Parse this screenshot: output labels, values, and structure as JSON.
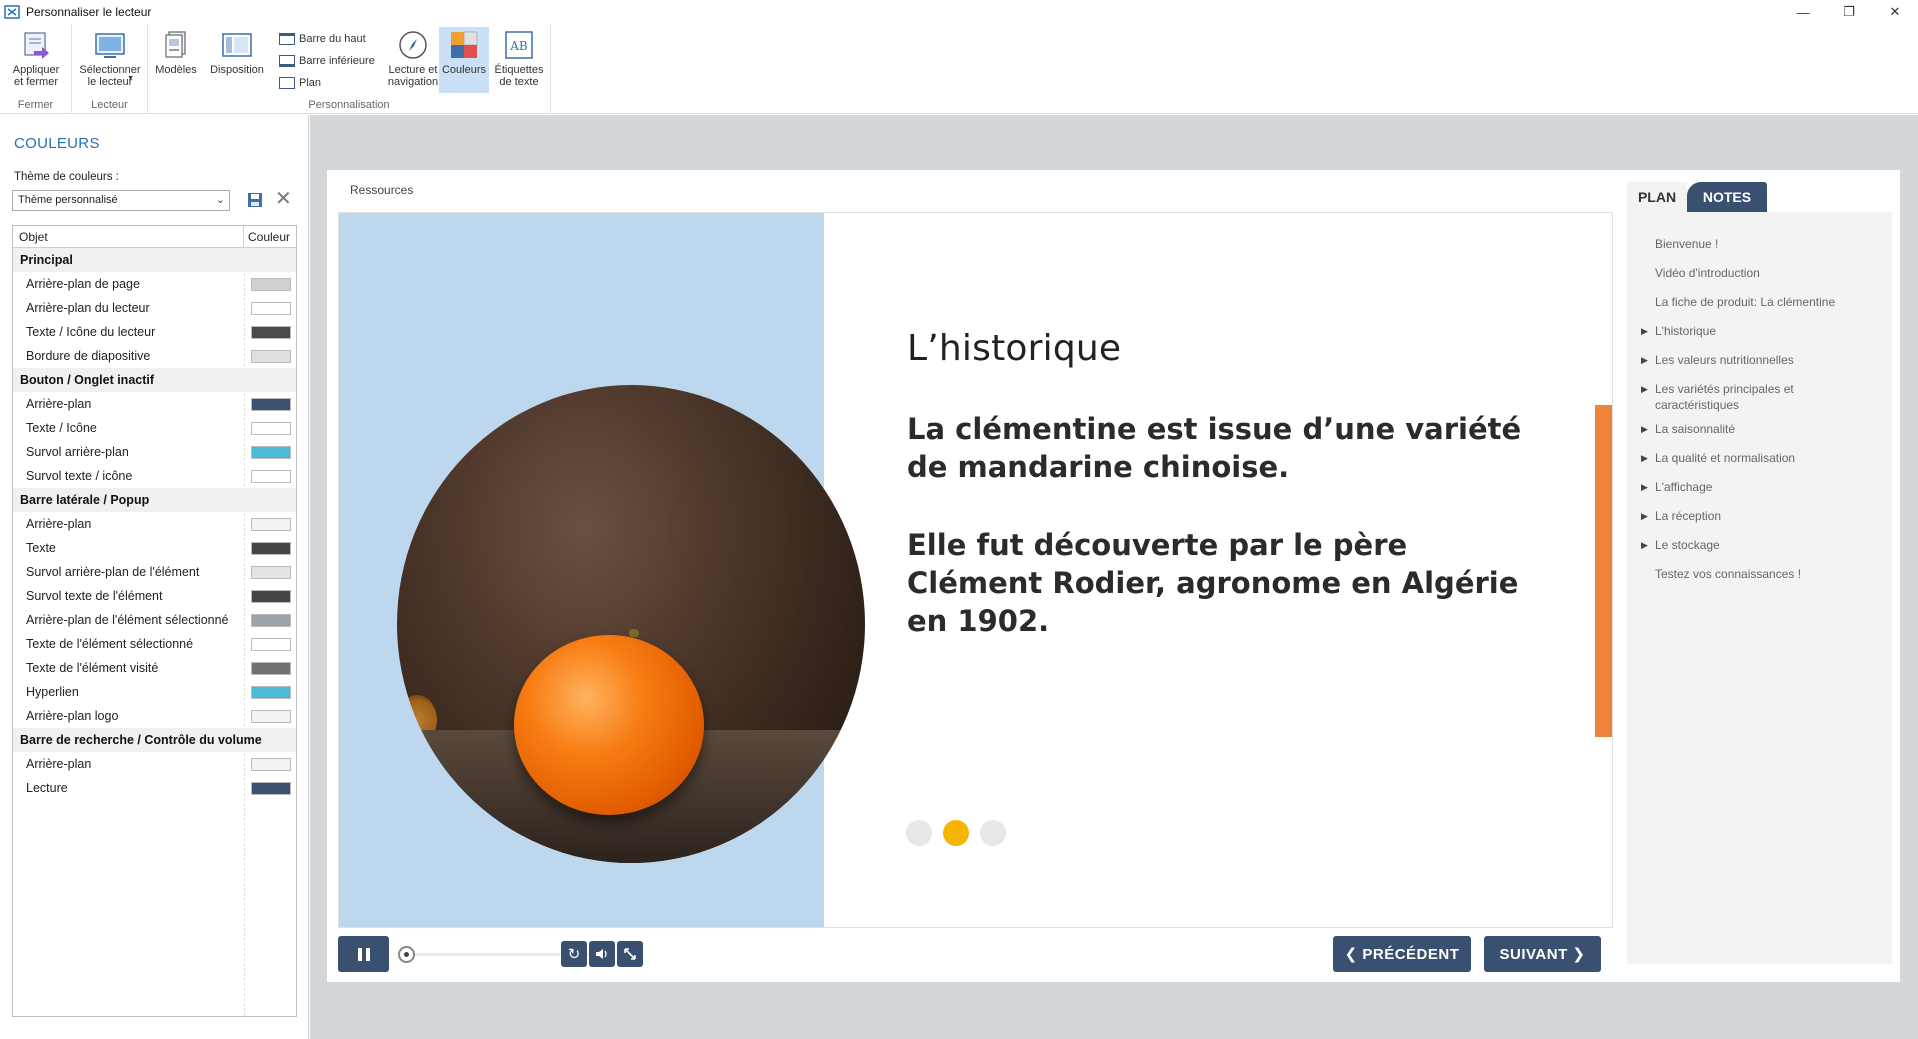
{
  "window": {
    "title": "Personnaliser le lecteur",
    "btn_min": "—",
    "btn_restore": "❐",
    "btn_close": "✕"
  },
  "ribbon": {
    "groups": {
      "fermer": "Fermer",
      "lecteur": "Lecteur",
      "personnalisation": "Personnalisation"
    },
    "apply_close": "Appliquer et fermer",
    "select_player": "Sélectionner le lecteur",
    "models": "Modèles",
    "layout": "Disposition",
    "top_bar": "Barre du haut",
    "bottom_bar": "Barre inférieure",
    "plan": "Plan",
    "playback_nav": "Lecture et navigation",
    "colors": "Couleurs",
    "text_labels": "Étiquettes de texte"
  },
  "left_panel": {
    "title": "COULEURS",
    "theme_label": "Thème de couleurs :",
    "theme_value": "Thème personnalisé",
    "col_object": "Objet",
    "col_color": "Couleur",
    "groups": [
      {
        "name": "Principal",
        "rows": [
          {
            "label": "Arrière-plan de page",
            "color": "#d0d0d0"
          },
          {
            "label": "Arrière-plan du lecteur",
            "color": "#ffffff"
          },
          {
            "label": "Texte / Icône du lecteur",
            "color": "#4a4a4a"
          },
          {
            "label": "Bordure de diapositive",
            "color": "#e0e0e0"
          }
        ]
      },
      {
        "name": "Bouton / Onglet inactif",
        "rows": [
          {
            "label": "Arrière-plan",
            "color": "#3d5270"
          },
          {
            "label": "Texte / Icône",
            "color": "#ffffff"
          },
          {
            "label": "Survol arrière-plan",
            "color": "#4bbbd8"
          },
          {
            "label": "Survol texte / icône",
            "color": "#ffffff"
          }
        ]
      },
      {
        "name": "Barre latérale / Popup",
        "rows": [
          {
            "label": "Arrière-plan",
            "color": "#f3f3f3"
          },
          {
            "label": "Texte",
            "color": "#454545"
          },
          {
            "label": "Survol arrière-plan de l'élément",
            "color": "#e4e4e4"
          },
          {
            "label": "Survol texte de l'élément",
            "color": "#454545"
          },
          {
            "label": "Arrière-plan de l'élément sélectionné",
            "color": "#9aa2aa"
          },
          {
            "label": "Texte de l'élément sélectionné",
            "color": "#ffffff"
          },
          {
            "label": "Texte de l'élément visité",
            "color": "#727272"
          },
          {
            "label": "Hyperlien",
            "color": "#4bbbd8"
          },
          {
            "label": "Arrière-plan logo",
            "color": "#f3f3f3"
          }
        ]
      },
      {
        "name": "Barre de recherche / Contrôle du volume",
        "rows": [
          {
            "label": "Arrière-plan",
            "color": "#f3f3f3"
          },
          {
            "label": "Lecture",
            "color": "#3d5270"
          }
        ]
      }
    ]
  },
  "player": {
    "resources": "Ressources",
    "slide": {
      "title": "L’historique",
      "para1": "La clémentine est issue d’une variété de mandarine chinoise.",
      "para2": "Elle fut découverte par le père Clément Rodier, agronome en Algérie en 1902.",
      "active_dot": 2
    },
    "prev": "❮  PRÉCÉDENT",
    "next": "SUIVANT  ❯",
    "tabs": {
      "plan": "PLAN",
      "notes": "NOTES"
    },
    "outline": [
      {
        "label": "Bienvenue !",
        "expandable": false
      },
      {
        "label": "Vidéo d'introduction",
        "expandable": false
      },
      {
        "label": "La fiche de produit: La clémentine",
        "expandable": false
      },
      {
        "label": "L'historique",
        "expandable": true
      },
      {
        "label": "Les valeurs nutritionnelles",
        "expandable": true
      },
      {
        "label": "Les variétés principales et caractéristiques",
        "expandable": true
      },
      {
        "label": "La saisonnalité",
        "expandable": true
      },
      {
        "label": "La qualité et normalisation",
        "expandable": true
      },
      {
        "label": "L'affichage",
        "expandable": true
      },
      {
        "label": "La réception",
        "expandable": true
      },
      {
        "label": "Le stockage",
        "expandable": true
      },
      {
        "label": "Testez vos connaissances !",
        "expandable": false
      }
    ]
  }
}
